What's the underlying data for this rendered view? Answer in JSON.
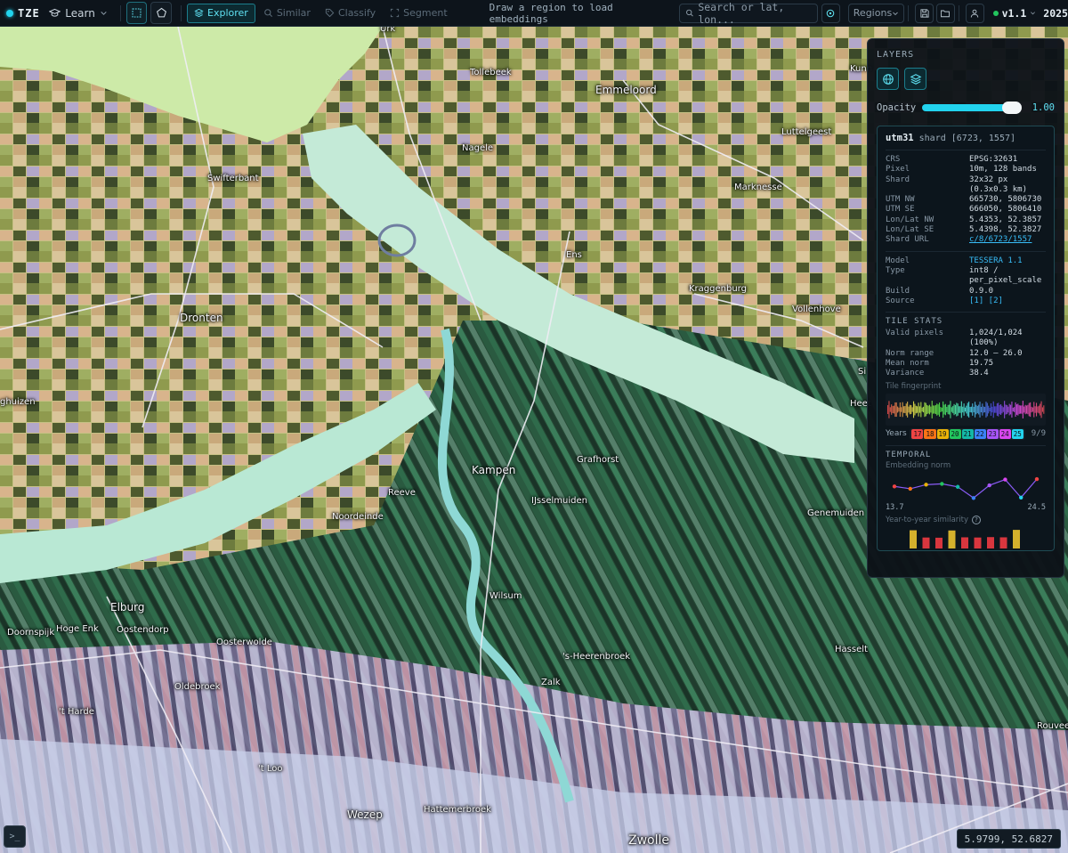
{
  "app": {
    "name": "TZE"
  },
  "topbar": {
    "learn_label": "Learn",
    "modes": [
      {
        "label": "Explorer",
        "active": true
      },
      {
        "label": "Similar",
        "active": false
      },
      {
        "label": "Classify",
        "active": false
      },
      {
        "label": "Segment",
        "active": false
      }
    ],
    "hint": "Draw a region to load embeddings",
    "search_placeholder": "Search or lat, lon...",
    "regions_label": "Regions",
    "version": "v1.1",
    "year": "2025"
  },
  "map": {
    "places": [
      {
        "name": "Urk"
      },
      {
        "name": "Tollebeek"
      },
      {
        "name": "Emmeloord"
      },
      {
        "name": "Nagele"
      },
      {
        "name": "Luttelgeest"
      },
      {
        "name": "Swifterbant"
      },
      {
        "name": "Marknesse"
      },
      {
        "name": "Ens"
      },
      {
        "name": "Kraggenburg"
      },
      {
        "name": "Vollenhove"
      },
      {
        "name": "Dronten"
      },
      {
        "name": "ghuizen"
      },
      {
        "name": "Kampen"
      },
      {
        "name": "Grafhorst"
      },
      {
        "name": "Reeve"
      },
      {
        "name": "IJsselmuiden"
      },
      {
        "name": "Noordeinde"
      },
      {
        "name": "Genemuiden"
      },
      {
        "name": "Elburg"
      },
      {
        "name": "Wilsum"
      },
      {
        "name": "Doornspijk"
      },
      {
        "name": "Hoge Enk"
      },
      {
        "name": "Oostendorp"
      },
      {
        "name": "Oosterwolde"
      },
      {
        "name": "'s-Heerenbroek"
      },
      {
        "name": "Hasselt"
      },
      {
        "name": "Oldebroek"
      },
      {
        "name": "Zalk"
      },
      {
        "name": "'t Harde"
      },
      {
        "name": "Rouveen"
      },
      {
        "name": "'t Loo"
      },
      {
        "name": "Wezep"
      },
      {
        "name": "Hattemerbroek"
      },
      {
        "name": "Zwolle"
      },
      {
        "name": "Kunn"
      },
      {
        "name": "Si"
      },
      {
        "name": "Heet"
      }
    ],
    "cursor_coords": "5.9799, 52.6827",
    "terminal_label": ">_"
  },
  "layers_panel": {
    "title": "LAYERS",
    "opacity_label": "Opacity",
    "opacity_value": "1.00",
    "opacity": 1.0,
    "shard": {
      "zone": "utm31",
      "label": "shard [6723, 1557]",
      "rows": [
        {
          "k": "CRS",
          "v": "EPSG:32631"
        },
        {
          "k": "Pixel",
          "v": "10m, 128 bands"
        },
        {
          "k": "Shard",
          "v": "32x32 px"
        },
        {
          "k": "",
          "v": "(0.3x0.3 km)"
        },
        {
          "k": "UTM NW",
          "v": "665730, 5806730"
        },
        {
          "k": "UTM SE",
          "v": "666050, 5806410"
        },
        {
          "k": "Lon/Lat NW",
          "v": "5.4353, 52.3857"
        },
        {
          "k": "Lon/Lat SE",
          "v": "5.4398, 52.3827"
        },
        {
          "k": "Shard URL",
          "v": "c/8/6723/1557"
        }
      ],
      "model_rows": [
        {
          "k": "Model",
          "v": "TESSERA 1.1"
        },
        {
          "k": "Type",
          "v": "int8 /"
        },
        {
          "k": "",
          "v": "per_pixel_scale"
        },
        {
          "k": "Build",
          "v": "0.9.0"
        },
        {
          "k": "Source",
          "v": "[1] [2]"
        }
      ]
    },
    "tile_stats": {
      "title": "TILE STATS",
      "rows": [
        {
          "k": "Valid pixels",
          "v": "1,024/1,024"
        },
        {
          "k": "",
          "v": "(100%)"
        },
        {
          "k": "Norm range",
          "v": "12.0 – 26.0"
        },
        {
          "k": "Mean norm",
          "v": "19.75"
        },
        {
          "k": "Variance",
          "v": "38.4"
        }
      ],
      "fingerprint_label": "Tile fingerprint",
      "years_label": "Years",
      "years": [
        "17",
        "18",
        "19",
        "20",
        "21",
        "22",
        "23",
        "24",
        "25"
      ],
      "year_colors": [
        "#ef4444",
        "#f97316",
        "#eab308",
        "#22c55e",
        "#14b8a6",
        "#3b82f6",
        "#a855f7",
        "#d946ef",
        "#22d3ee"
      ],
      "years_count": "9/9"
    },
    "temporal": {
      "title": "TEMPORAL",
      "norm_label": "Embedding norm",
      "norm_values": [
        19.4,
        18.3,
        20.2,
        20.6,
        19.2,
        14.0,
        19.9,
        22.6,
        14.2,
        22.8
      ],
      "norm_min": "13.7",
      "norm_max": "24.5",
      "similarity_label": "Year-to-year similarity",
      "similarity_values": [
        0.93,
        0.56,
        0.55,
        0.92,
        0.57,
        0.56,
        0.58,
        0.57,
        0.95
      ],
      "similarity_colors": [
        "#d4b12c",
        "#d9363e",
        "#d9363e",
        "#d4b12c",
        "#d9363e",
        "#d9363e",
        "#d9363e",
        "#d9363e",
        "#d4b12c"
      ]
    }
  }
}
